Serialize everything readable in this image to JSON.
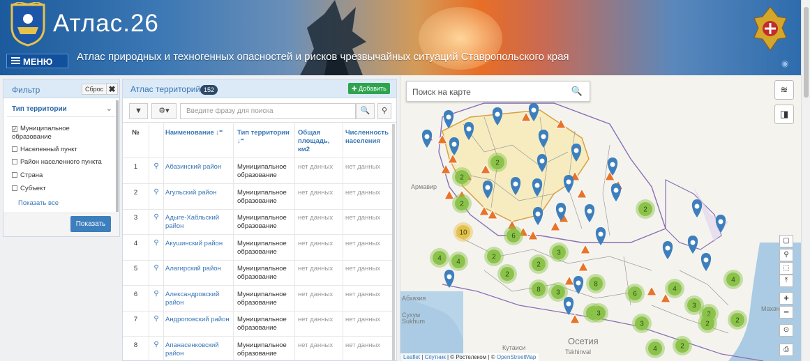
{
  "header": {
    "brand": "Атлас.26",
    "menu_label": "МЕНЮ",
    "subtitle": "Атлас природных и техногенных опасностей и рисков чрезвычайных ситуаций Ставропольского края"
  },
  "filter": {
    "title": "Фильтр",
    "reset_label": "Сброс",
    "close_glyph": "✖",
    "type_heading": "Тип территории",
    "options": [
      {
        "label": "Муниципальное образование",
        "checked": true
      },
      {
        "label": "Населенный пункт",
        "checked": false
      },
      {
        "label": "Район населенного пункта",
        "checked": false
      },
      {
        "label": "Страна",
        "checked": false
      },
      {
        "label": "Субъект",
        "checked": false
      }
    ],
    "show_all": "Показать все",
    "show_button": "Показать"
  },
  "atlas": {
    "title": "Атлас территорий",
    "count": "152",
    "add_label": "Добавить",
    "search_placeholder": "Введите фразу для поиска",
    "columns": {
      "num": "№",
      "name": "Наименование",
      "type": "Тип территории",
      "area": "Общая площадь, км2",
      "pop": "Численность населения"
    },
    "rows": [
      {
        "num": "1",
        "name": "Абазинский район",
        "type": "Муниципальное образование",
        "area": "нет данных",
        "pop": "нет данных"
      },
      {
        "num": "2",
        "name": "Агульский район",
        "type": "Муниципальное образование",
        "area": "нет данных",
        "pop": "нет данных"
      },
      {
        "num": "3",
        "name": "Адыге-Хабльский район",
        "type": "Муниципальное образование",
        "area": "нет данных",
        "pop": "нет данных"
      },
      {
        "num": "4",
        "name": "Акушинский район",
        "type": "Муниципальное образование",
        "area": "нет данных",
        "pop": "нет данных"
      },
      {
        "num": "5",
        "name": "Алагирский район",
        "type": "Муниципальное образование",
        "area": "нет данных",
        "pop": "нет данных"
      },
      {
        "num": "6",
        "name": "Александровский район",
        "type": "Муниципальное образование",
        "area": "нет данных",
        "pop": "нет данных"
      },
      {
        "num": "7",
        "name": "Андроповский район",
        "type": "Муниципальное образование",
        "area": "нет данных",
        "pop": "нет данных"
      },
      {
        "num": "8",
        "name": "Апанасенковский район",
        "type": "Муниципальное образование",
        "area": "нет данных",
        "pop": "нет данных"
      }
    ]
  },
  "map": {
    "search_placeholder": "Поиск на карте",
    "labels": [
      "Армавир",
      "Абхазия",
      "Сухум",
      "Sukhum",
      "Махачкала",
      "Осетия",
      "Tskhinval",
      "Кутаиси"
    ],
    "clusters": [
      {
        "n": "2",
        "color": "#8bc34a"
      },
      {
        "n": "2",
        "color": "#8bc34a"
      },
      {
        "n": "2",
        "color": "#8bc34a"
      },
      {
        "n": "10",
        "color": "#e6c04a"
      },
      {
        "n": "6",
        "color": "#8bc34a"
      },
      {
        "n": "4",
        "color": "#8bc34a"
      },
      {
        "n": "4",
        "color": "#8bc34a"
      },
      {
        "n": "2",
        "color": "#8bc34a"
      },
      {
        "n": "3",
        "color": "#8bc34a"
      },
      {
        "n": "2",
        "color": "#8bc34a"
      },
      {
        "n": "2",
        "color": "#8bc34a"
      },
      {
        "n": "2",
        "color": "#8bc34a"
      },
      {
        "n": "4",
        "color": "#8bc34a"
      },
      {
        "n": "2",
        "color": "#8bc34a"
      },
      {
        "n": "8",
        "color": "#8bc34a"
      },
      {
        "n": "3",
        "color": "#8bc34a"
      },
      {
        "n": "8",
        "color": "#8bc34a"
      },
      {
        "n": "6",
        "color": "#8bc34a"
      },
      {
        "n": "4",
        "color": "#8bc34a"
      },
      {
        "n": "3",
        "color": "#8bc34a"
      },
      {
        "n": "2",
        "color": "#8bc34a"
      },
      {
        "n": "3",
        "color": "#8bc34a"
      },
      {
        "n": "3",
        "color": "#8bc34a"
      },
      {
        "n": "2",
        "color": "#8bc34a"
      },
      {
        "n": "2",
        "color": "#8bc34a"
      },
      {
        "n": "2",
        "color": "#8bc34a"
      },
      {
        "n": "4",
        "color": "#8bc34a"
      }
    ],
    "attribution": {
      "leaflet": "Leaflet",
      "sputnik": "Спутник",
      "rostelecom": "© Ростелеком",
      "osm": "OpenStreetMap"
    },
    "colors": {
      "pin": "#3d7fbd",
      "hazard": "#e8742a",
      "border": "#8a6fb6"
    }
  }
}
